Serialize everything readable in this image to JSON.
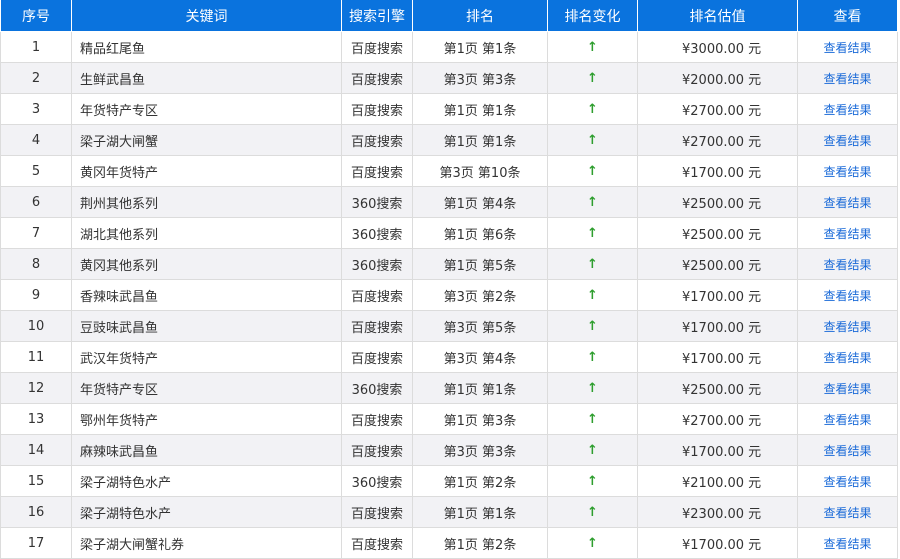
{
  "table": {
    "headers": {
      "index": "序号",
      "keyword": "关键词",
      "engine": "搜索引擎",
      "rank": "排名",
      "change": "排名变化",
      "value": "排名估值",
      "view": "查看"
    },
    "rows": [
      {
        "index": "1",
        "keyword": "精品红尾鱼",
        "engine": "百度搜索",
        "rank": "第1页 第1条",
        "change": "↑",
        "value": "¥3000.00 元",
        "view": "查看结果"
      },
      {
        "index": "2",
        "keyword": "生鲜武昌鱼",
        "engine": "百度搜索",
        "rank": "第3页 第3条",
        "change": "↑",
        "value": "¥2000.00 元",
        "view": "查看结果"
      },
      {
        "index": "3",
        "keyword": "年货特产专区",
        "engine": "百度搜索",
        "rank": "第1页 第1条",
        "change": "↑",
        "value": "¥2700.00 元",
        "view": "查看结果"
      },
      {
        "index": "4",
        "keyword": "梁子湖大闸蟹",
        "engine": "百度搜索",
        "rank": "第1页 第1条",
        "change": "↑",
        "value": "¥2700.00 元",
        "view": "查看结果"
      },
      {
        "index": "5",
        "keyword": "黄冈年货特产",
        "engine": "百度搜索",
        "rank": "第3页 第10条",
        "change": "↑",
        "value": "¥1700.00 元",
        "view": "查看结果"
      },
      {
        "index": "6",
        "keyword": "荆州其他系列",
        "engine": "360搜索",
        "rank": "第1页 第4条",
        "change": "↑",
        "value": "¥2500.00 元",
        "view": "查看结果"
      },
      {
        "index": "7",
        "keyword": "湖北其他系列",
        "engine": "360搜索",
        "rank": "第1页 第6条",
        "change": "↑",
        "value": "¥2500.00 元",
        "view": "查看结果"
      },
      {
        "index": "8",
        "keyword": "黄冈其他系列",
        "engine": "360搜索",
        "rank": "第1页 第5条",
        "change": "↑",
        "value": "¥2500.00 元",
        "view": "查看结果"
      },
      {
        "index": "9",
        "keyword": "香辣味武昌鱼",
        "engine": "百度搜索",
        "rank": "第3页 第2条",
        "change": "↑",
        "value": "¥1700.00 元",
        "view": "查看结果"
      },
      {
        "index": "10",
        "keyword": "豆豉味武昌鱼",
        "engine": "百度搜索",
        "rank": "第3页 第5条",
        "change": "↑",
        "value": "¥1700.00 元",
        "view": "查看结果"
      },
      {
        "index": "11",
        "keyword": "武汉年货特产",
        "engine": "百度搜索",
        "rank": "第3页 第4条",
        "change": "↑",
        "value": "¥1700.00 元",
        "view": "查看结果"
      },
      {
        "index": "12",
        "keyword": "年货特产专区",
        "engine": "360搜索",
        "rank": "第1页 第1条",
        "change": "↑",
        "value": "¥2500.00 元",
        "view": "查看结果"
      },
      {
        "index": "13",
        "keyword": "鄂州年货特产",
        "engine": "百度搜索",
        "rank": "第1页 第3条",
        "change": "↑",
        "value": "¥2700.00 元",
        "view": "查看结果"
      },
      {
        "index": "14",
        "keyword": "麻辣味武昌鱼",
        "engine": "百度搜索",
        "rank": "第3页 第3条",
        "change": "↑",
        "value": "¥1700.00 元",
        "view": "查看结果"
      },
      {
        "index": "15",
        "keyword": "梁子湖特色水产",
        "engine": "360搜索",
        "rank": "第1页 第2条",
        "change": "↑",
        "value": "¥2100.00 元",
        "view": "查看结果"
      },
      {
        "index": "16",
        "keyword": "梁子湖特色水产",
        "engine": "百度搜索",
        "rank": "第1页 第1条",
        "change": "↑",
        "value": "¥2300.00 元",
        "view": "查看结果"
      },
      {
        "index": "17",
        "keyword": "梁子湖大闸蟹礼券",
        "engine": "百度搜索",
        "rank": "第1页 第2条",
        "change": "↑",
        "value": "¥1700.00 元",
        "view": "查看结果"
      }
    ]
  },
  "colors": {
    "header_bg": "#0a73de",
    "header_text": "#ffffff",
    "even_row_bg": "#f2f2f5",
    "arrow_up": "#2e9e2e",
    "link": "#1a6ad8"
  },
  "icons": {
    "rank_change": "arrow-up-icon"
  }
}
